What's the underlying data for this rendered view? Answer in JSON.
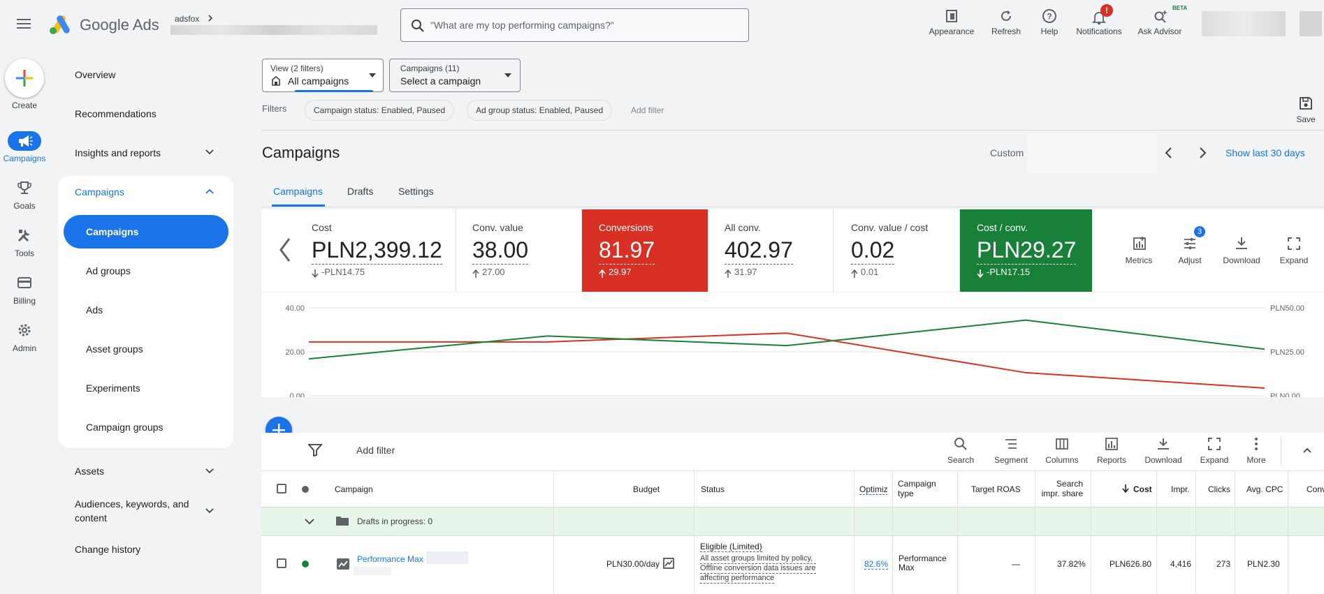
{
  "header": {
    "app_name": "Google Ads",
    "account_label": "adsfox",
    "search_placeholder": "\"What are my top performing campaigns?\"",
    "actions": [
      {
        "label": "Appearance",
        "icon": "appearance-icon"
      },
      {
        "label": "Refresh",
        "icon": "refresh-icon"
      },
      {
        "label": "Help",
        "icon": "help-icon"
      },
      {
        "label": "Notifications",
        "icon": "bell-icon",
        "badge": "!"
      },
      {
        "label": "Ask Advisor",
        "icon": "sparkle-search-icon",
        "tag": "BETA"
      }
    ]
  },
  "rail": {
    "create_label": "Create",
    "items": [
      {
        "label": "Campaigns",
        "icon": "megaphone-icon",
        "active": true
      },
      {
        "label": "Goals",
        "icon": "trophy-icon"
      },
      {
        "label": "Tools",
        "icon": "tools-icon"
      },
      {
        "label": "Billing",
        "icon": "card-icon"
      },
      {
        "label": "Admin",
        "icon": "gear-icon"
      }
    ]
  },
  "nav": {
    "overview": "Overview",
    "recommendations": "Recommendations",
    "insights": "Insights and reports",
    "campaigns_group": "Campaigns",
    "sub": [
      "Campaigns",
      "Ad groups",
      "Ads",
      "Asset groups",
      "Experiments",
      "Campaign groups"
    ],
    "assets": "Assets",
    "audiences_line1": "Audiences, keywords, and",
    "audiences_line2": "content",
    "change_history": "Change history"
  },
  "selectors": {
    "view_label": "View (2 filters)",
    "view_value": "All campaigns",
    "campaigns_label": "Campaigns (11)",
    "campaigns_value": "Select a campaign"
  },
  "filters": {
    "label": "Filters",
    "chips": [
      "Campaign status: Enabled, Paused",
      "Ad group status: Enabled, Paused"
    ],
    "add": "Add filter",
    "save": "Save"
  },
  "page": {
    "title": "Campaigns",
    "date_label": "Custom",
    "show_last": "Show last 30 days",
    "tabs": [
      "Campaigns",
      "Drafts",
      "Settings"
    ]
  },
  "scorecards": [
    {
      "label": "Cost",
      "value": "PLN2,399.12",
      "delta": "-PLN14.75",
      "dir": "down"
    },
    {
      "label": "Conv. value",
      "value": "38.00",
      "delta": "27.00",
      "dir": "up"
    },
    {
      "label": "Conversions",
      "value": "81.97",
      "delta": "29.97",
      "dir": "up",
      "color": "#d93025"
    },
    {
      "label": "All conv.",
      "value": "402.97",
      "delta": "31.97",
      "dir": "up"
    },
    {
      "label": "Conv. value / cost",
      "value": "0.02",
      "delta": "0.01",
      "dir": "up"
    },
    {
      "label": "Cost / conv.",
      "value": "PLN29.27",
      "delta": "-PLN17.15",
      "dir": "down",
      "color": "#188038"
    }
  ],
  "card_tools": {
    "metrics": "Metrics",
    "adjust": "Adjust",
    "adjust_badge": "3",
    "download": "Download",
    "expand": "Expand"
  },
  "chart_data": {
    "type": "line",
    "x": [
      1,
      2,
      3,
      4,
      5
    ],
    "series": [
      {
        "values": [
          24.5,
          24.5,
          28.5,
          10.5,
          3.5
        ],
        "color": "#d93025",
        "axis": "left"
      },
      {
        "values": [
          21.0,
          34.0,
          28.5,
          43.0,
          26.5
        ],
        "color": "#188038",
        "axis": "right"
      }
    ],
    "left_ticks": [
      "40.00",
      "20.00",
      "0.00"
    ],
    "right_ticks": [
      "PLN50.00",
      "PLN25.00",
      "PLN0.00"
    ],
    "ylim_left": [
      0,
      40
    ],
    "ylim_right": [
      0,
      50
    ]
  },
  "table_tools": {
    "add_filter": "Add filter",
    "buttons": [
      "Search",
      "Segment",
      "Columns",
      "Reports",
      "Download",
      "Expand",
      "More"
    ]
  },
  "table": {
    "headers": {
      "campaign": "Campaign",
      "budget": "Budget",
      "status": "Status",
      "optim": "Optimiz",
      "type_1": "Campaign",
      "type_2": "type",
      "target_roas": "Target ROAS",
      "share_1": "Search",
      "share_2": "impr. share",
      "cost": "Cost",
      "impr": "Impr.",
      "clicks": "Clicks",
      "avg_cpc": "Avg. CPC",
      "conv": "Conv"
    },
    "drafts_row": "Drafts in progress: 0",
    "row": {
      "campaign": "Performance Max",
      "budget": "PLN30.00/day",
      "status_title": "Eligible (Limited)",
      "status_1": "All asset groups limited by policy,",
      "status_2": "Offline conversion data issues are",
      "status_3": "affecting performance",
      "optim": "82.6%",
      "type_1": "Performance",
      "type_2": "Max",
      "target_roas": "—",
      "share": "37.82%",
      "cost": "PLN626.80",
      "impr": "4,416",
      "clicks": "273",
      "avg_cpc": "PLN2.30"
    }
  }
}
